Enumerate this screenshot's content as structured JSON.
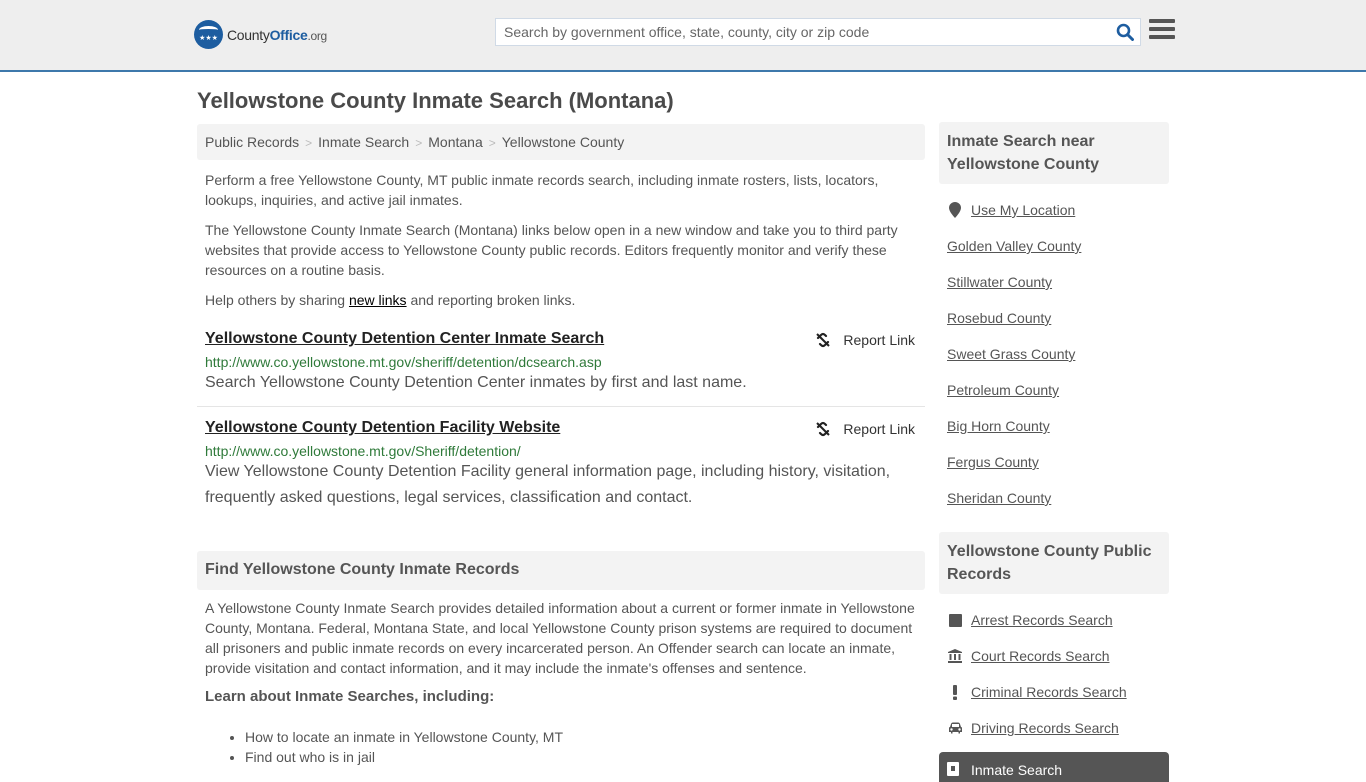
{
  "header": {
    "logo": {
      "name_part1": "County",
      "name_part2": "Office",
      "suffix": ".org",
      "stars": "★★★"
    },
    "search": {
      "placeholder": "Search by government office, state, county, city or zip code",
      "value": ""
    },
    "colors": {
      "brand": "#1d5da0",
      "accent_border": "#3e78ab",
      "header_bg": "#eeeeee"
    }
  },
  "page": {
    "title": "Yellowstone County Inmate Search (Montana)"
  },
  "breadcrumb": {
    "items": [
      "Public Records",
      "Inmate Search",
      "Montana",
      "Yellowstone County"
    ],
    "separator": ">"
  },
  "intro": {
    "p1": "Perform a free Yellowstone County, MT public inmate records search, including inmate rosters, lists, locators, lookups, inquiries, and active jail inmates.",
    "p2": "The Yellowstone County Inmate Search (Montana) links below open in a new window and take you to third party websites that provide access to Yellowstone County public records. Editors frequently monitor and verify these resources on a routine basis.",
    "p3_before": "Help others by sharing ",
    "p3_link": "new links",
    "p3_after": " and reporting broken links."
  },
  "results": [
    {
      "title": "Yellowstone County Detention Center Inmate Search",
      "url": "http://www.co.yellowstone.mt.gov/sheriff/detention/dcsearch.asp",
      "description": "Search Yellowstone County Detention Center inmates by first and last name.",
      "report_label": "Report Link"
    },
    {
      "title": "Yellowstone County Detention Facility Website",
      "url": "http://www.co.yellowstone.mt.gov/Sheriff/detention/",
      "description": "View Yellowstone County Detention Facility general information page, including history, visitation, frequently asked questions, legal services, classification and contact.",
      "report_label": "Report Link"
    }
  ],
  "find": {
    "heading": "Find Yellowstone County Inmate Records",
    "body": "A Yellowstone County Inmate Search provides detailed information about a current or former inmate in Yellowstone County, Montana. Federal, Montana State, and local Yellowstone County prison systems are required to document all prisoners and public inmate records on every incarcerated person. An Offender search can locate an inmate, provide visitation and contact information, and it may include the inmate's offenses and sentence.",
    "learn_heading": "Learn about Inmate Searches, including:",
    "bullets": [
      "How to locate an inmate in Yellowstone County, MT",
      "Find out who is in jail"
    ]
  },
  "sidebar": {
    "nearby": {
      "heading": "Inmate Search near Yellowstone County",
      "use_location": {
        "label": "Use My Location",
        "icon": "map-marker-icon"
      },
      "counties": [
        "Golden Valley County",
        "Stillwater County",
        "Rosebud County",
        "Sweet Grass County",
        "Petroleum County",
        "Big Horn County",
        "Fergus County",
        "Sheridan County"
      ]
    },
    "public_records": {
      "heading": "Yellowstone County Public Records",
      "items": [
        {
          "label": "Arrest Records Search",
          "icon": "square-icon"
        },
        {
          "label": "Court Records Search",
          "icon": "courthouse-icon"
        },
        {
          "label": "Criminal Records Search",
          "icon": "exclamation-icon"
        },
        {
          "label": "Driving Records Search",
          "icon": "car-icon"
        }
      ],
      "active": {
        "label": "Inmate Search",
        "icon": "jail-door-icon"
      }
    }
  }
}
